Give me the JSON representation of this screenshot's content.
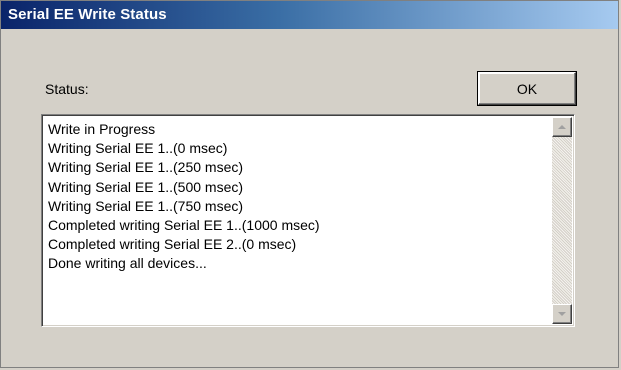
{
  "window": {
    "title": "Serial EE Write Status"
  },
  "status": {
    "label": "Status:"
  },
  "buttons": {
    "ok_label": "OK"
  },
  "log": {
    "lines": [
      "Write in Progress",
      "Writing Serial EE 1..(0 msec)",
      "Writing Serial EE 1..(250 msec)",
      "Writing Serial EE 1..(500 msec)",
      "Writing Serial EE 1..(750 msec)",
      "Completed writing Serial EE 1..(1000 msec)",
      "Completed writing Serial EE 2..(0 msec)",
      "Done writing all devices..."
    ]
  },
  "icons": {
    "scroll_up": "scroll-up-arrow-icon",
    "scroll_down": "scroll-down-arrow-icon"
  },
  "colors": {
    "title_gradient_start": "#0a246a",
    "title_gradient_end": "#a6caf0",
    "dialog_background": "#d4d0c8"
  }
}
